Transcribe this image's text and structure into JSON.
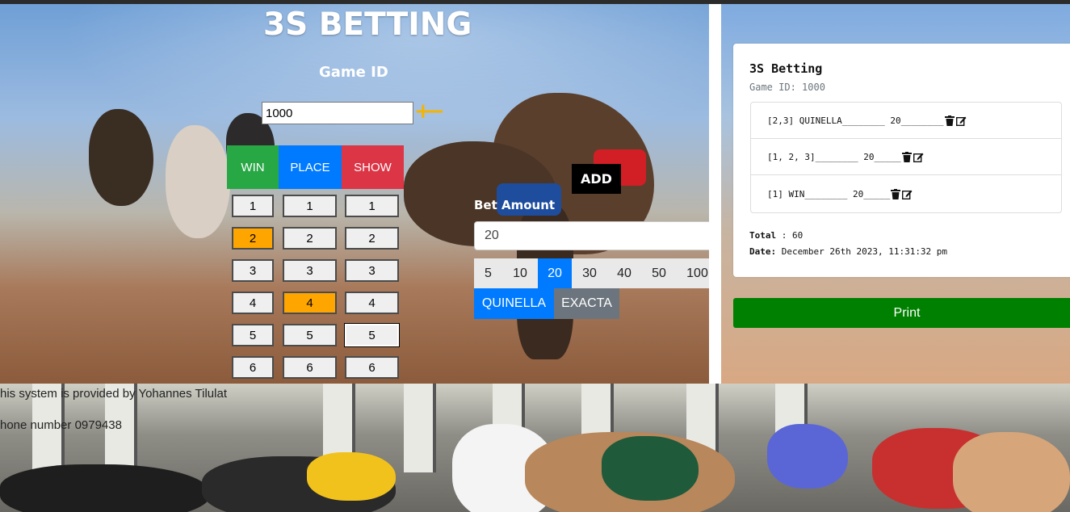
{
  "app": {
    "title": "3S BETTING"
  },
  "game": {
    "label": "Game ID",
    "value": "1000",
    "plus": "+",
    "minus": "−"
  },
  "tabs": {
    "win": "WIN",
    "place": "PLACE",
    "show": "SHOW"
  },
  "numbers": [
    "1",
    "2",
    "3",
    "4",
    "5",
    "6"
  ],
  "selected": {
    "win": "2",
    "place": "4"
  },
  "add_label": "ADD",
  "bet": {
    "label": "Bet Amount",
    "value": "20",
    "amounts": [
      "5",
      "10",
      "20",
      "30",
      "40",
      "50",
      "100"
    ],
    "selected_amount": "20",
    "types": [
      "QUINELLA",
      "EXACTA"
    ]
  },
  "receipt": {
    "title": "3S Betting",
    "subtitle": "Game ID: 1000",
    "items": [
      {
        "text": "[2,3] QUINELLA________ 20________"
      },
      {
        "text": "[1, 2, 3]________ 20_____"
      },
      {
        "text": "[1] WIN________ 20_____"
      }
    ],
    "total_label": "Total",
    "total_value": ": 60",
    "date_label": "Date:",
    "date_value": "December 26th 2023, 11:31:32 pm"
  },
  "print_label": "Print",
  "footer": {
    "line1": "his system is provided by Yohannes Tilulat",
    "line2": "hone number 0979438"
  },
  "colors": {
    "win": "#28a745",
    "place": "#007bff",
    "show": "#dc3545",
    "selected": "#ffa500",
    "print": "#008000"
  }
}
